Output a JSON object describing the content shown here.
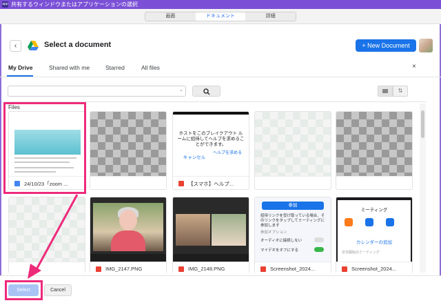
{
  "window": {
    "title": "共有するウィンドウまたはアプリケーションの選択",
    "app_icon_text": "app"
  },
  "source_tabs": [
    {
      "label": "画面",
      "active": false
    },
    {
      "label": "ドキュメント",
      "active": true
    },
    {
      "label": "詳細",
      "active": false
    }
  ],
  "header": {
    "back_icon": "chevron-left-icon",
    "logo_icon": "google-drive-logo",
    "title": "Select a document",
    "new_document_label": "+ New Document"
  },
  "drive_tabs": [
    {
      "label": "My Drive",
      "active": true
    },
    {
      "label": "Shared with me",
      "active": false
    },
    {
      "label": "Starred",
      "active": false
    },
    {
      "label": "All files",
      "active": false
    }
  ],
  "close_label": "×",
  "search": {
    "value": "",
    "dropdown_icon": "chevron-down-icon",
    "button_icon": "search-icon",
    "view_icon": "grid-view-icon",
    "sort_icon": "sort-icon"
  },
  "files_label": "Files",
  "files": [
    {
      "name": "24/10/23「zoom ...",
      "type": "doc"
    },
    {
      "name": "",
      "type": "blank"
    },
    {
      "name": "【スマホ】ヘルプ...",
      "type": "image"
    },
    {
      "name": "",
      "type": "blank"
    },
    {
      "name": "",
      "type": "blank"
    },
    {
      "name": "",
      "type": "blank"
    },
    {
      "name": "IMG_2147.PNG",
      "type": "image"
    },
    {
      "name": "IMG_2148.PNG",
      "type": "image"
    },
    {
      "name": "Screenshot_2024...",
      "type": "image"
    },
    {
      "name": "Screenshot_2024...",
      "type": "image"
    }
  ],
  "thumbs": {
    "phone_help_text": "ホストをこのブレイクアウト ルームに招待してヘルプを求めることができます。",
    "phone_cancel": "キャンセル",
    "phone_help": "ヘルプを求める",
    "zoom_join": "参加",
    "zoom_desc": "招待リンクを受け取っている場合、そのリンクをタップしてミーティングに参加します",
    "zoom_audio_header": "参加オプション",
    "zoom_audio_label": "オーディオに接続しない",
    "zoom_mic_label": "マイデオをオフにする",
    "meet_title": "ミーティング",
    "meet_link": "カレンダーの追加",
    "meet_sub": "近日開始のミーティング"
  },
  "footer": {
    "select_label": "Select",
    "cancel_label": "Cancel"
  },
  "colors": {
    "accent": "#1a73e8",
    "titlebar": "#7b50d6",
    "highlight": "#ee2a7b"
  }
}
